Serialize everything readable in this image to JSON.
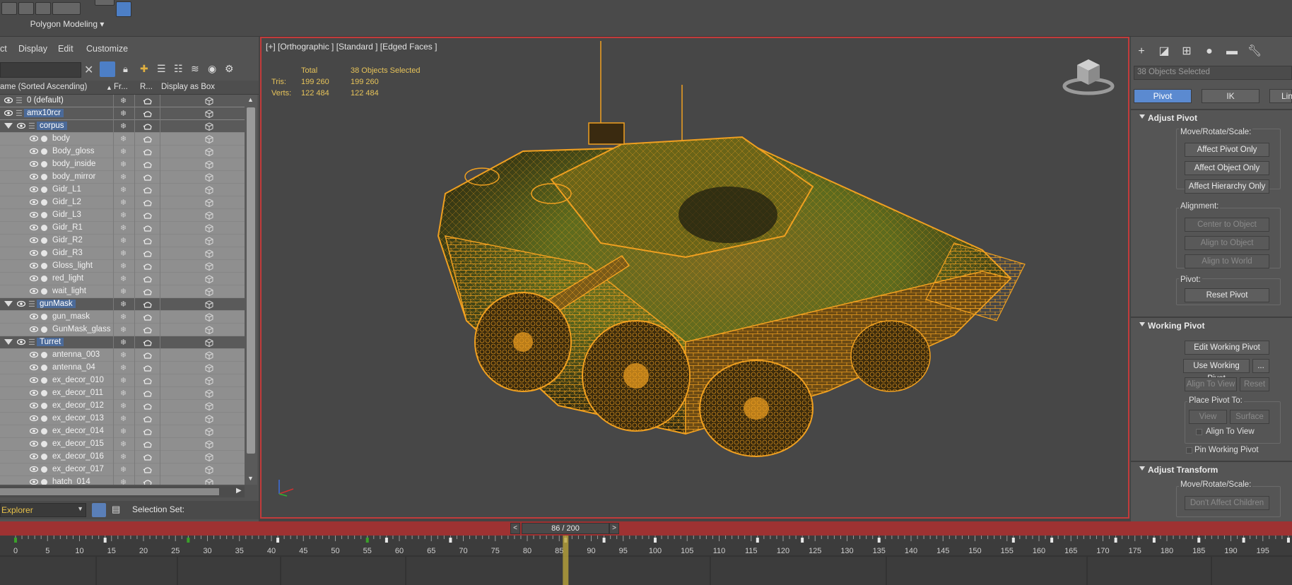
{
  "toolbar": {
    "mode_label": "Polygon Modeling"
  },
  "explorer": {
    "menu": [
      "ct",
      "Display",
      "Edit",
      "Customize"
    ],
    "columns": {
      "name": "ame (Sorted Ascending)",
      "freeze": "Fr...",
      "render": "R...",
      "box": "Display as Box"
    },
    "footer_dropdown": "Explorer",
    "selection_set": "Selection Set:",
    "rows": [
      {
        "label": "0 (default)",
        "level": 0,
        "group": true
      },
      {
        "label": "amx10rcr",
        "level": 0,
        "group": true,
        "highlight": true
      },
      {
        "label": "corpus",
        "level": 1,
        "group": true,
        "highlight": true,
        "expanded": true
      },
      {
        "label": "body",
        "level": 2
      },
      {
        "label": "Body_gloss",
        "level": 2
      },
      {
        "label": "body_inside",
        "level": 2
      },
      {
        "label": "body_mirror",
        "level": 2
      },
      {
        "label": "Gidr_L1",
        "level": 2
      },
      {
        "label": "Gidr_L2",
        "level": 2
      },
      {
        "label": "Gidr_L3",
        "level": 2
      },
      {
        "label": "Gidr_R1",
        "level": 2
      },
      {
        "label": "Gidr_R2",
        "level": 2
      },
      {
        "label": "Gidr_R3",
        "level": 2
      },
      {
        "label": "Gloss_light",
        "level": 2
      },
      {
        "label": "red_light",
        "level": 2
      },
      {
        "label": "wait_light",
        "level": 2
      },
      {
        "label": "gunMask",
        "level": 1,
        "group": true,
        "highlight": true,
        "expanded": true
      },
      {
        "label": "gun_mask",
        "level": 2
      },
      {
        "label": "GunMask_glass",
        "level": 2
      },
      {
        "label": "Turret",
        "level": 1,
        "group": true,
        "highlight": true,
        "expanded": true
      },
      {
        "label": "antenna_003",
        "level": 2
      },
      {
        "label": "antenna_04",
        "level": 2
      },
      {
        "label": "ex_decor_010",
        "level": 2
      },
      {
        "label": "ex_decor_011",
        "level": 2
      },
      {
        "label": "ex_decor_012",
        "level": 2
      },
      {
        "label": "ex_decor_013",
        "level": 2
      },
      {
        "label": "ex_decor_014",
        "level": 2
      },
      {
        "label": "ex_decor_015",
        "level": 2
      },
      {
        "label": "ex_decor_016",
        "level": 2
      },
      {
        "label": "ex_decor_017",
        "level": 2
      },
      {
        "label": "hatch_014",
        "level": 2
      }
    ]
  },
  "viewport": {
    "label": "[+] [Orthographic ] [Standard ] [Edged Faces ]",
    "stats": {
      "total_header": "Total",
      "selected_header": "38 Objects Selected",
      "tris_label": "Tris:",
      "tris_total": "199 260",
      "tris_selected": "199 260",
      "verts_label": "Verts:",
      "verts_total": "122 484",
      "verts_selected": "122 484"
    }
  },
  "command_panel": {
    "selection_text": "38 Objects Selected",
    "tabs": [
      "Pivot",
      "IK",
      "Link"
    ],
    "adjust_pivot": {
      "title": "Adjust Pivot",
      "move_label": "Move/Rotate/Scale:",
      "buttons": [
        "Affect Pivot Only",
        "Affect Object Only",
        "Affect Hierarchy Only"
      ],
      "alignment_label": "Alignment:",
      "align_buttons": [
        "Center to Object",
        "Align to Object",
        "Align to World"
      ],
      "pivot_label": "Pivot:",
      "reset_button": "Reset Pivot"
    },
    "working_pivot": {
      "title": "Working Pivot",
      "edit_button": "Edit Working Pivot",
      "use_button": "Use Working Pivot",
      "more_button": "...",
      "align_to_view": "Align To View",
      "reset": "Reset",
      "place_label": "Place Pivot To:",
      "view": "View",
      "surface": "Surface",
      "align_check": "Align To View",
      "pin_check": "Pin Working Pivot"
    },
    "adjust_transform": {
      "title": "Adjust Transform",
      "move_label": "Move/Rotate/Scale:",
      "dont_affect": "Don't Affect Children"
    }
  },
  "timeline": {
    "frame_text": "86 / 200",
    "current_frame": 86,
    "total_frames": 200,
    "ticks": [
      "0",
      "5",
      "10",
      "15",
      "20",
      "25",
      "30",
      "35",
      "40",
      "45",
      "50",
      "55",
      "60",
      "65",
      "70",
      "75",
      "80",
      "85",
      "90",
      "95",
      "100",
      "105",
      "110",
      "115",
      "120",
      "125",
      "130",
      "135",
      "140",
      "145",
      "150",
      "155",
      "160",
      "165",
      "170",
      "175",
      "180",
      "185",
      "190",
      "195",
      "20"
    ]
  },
  "colors": {
    "accent": "#5b8ad0",
    "wire": "#f0a020",
    "viewport_border": "#c23b3b",
    "timeline_red": "#9e3232"
  }
}
